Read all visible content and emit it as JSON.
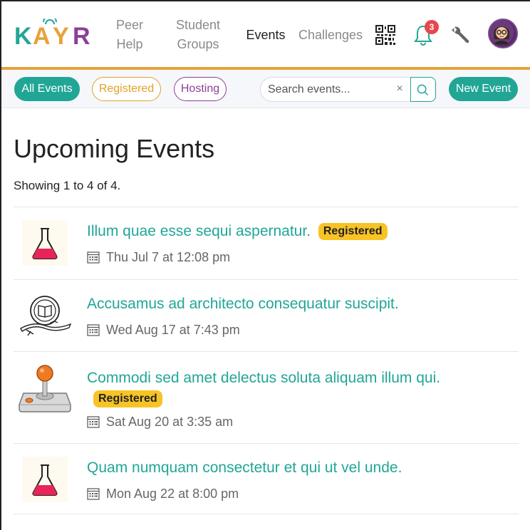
{
  "header": {
    "logo_text": "KAYR",
    "nav": [
      {
        "label_line1": "Peer",
        "label_line2": "Help"
      },
      {
        "label_line1": "Student",
        "label_line2": "Groups"
      },
      {
        "label": "Events"
      },
      {
        "label": "Challenges"
      }
    ],
    "notification_count": "3",
    "icons": [
      "qr-code-icon",
      "bell-icon",
      "wrench-icon",
      "avatar"
    ]
  },
  "filters": {
    "all": "All Events",
    "registered": "Registered",
    "hosting": "Hosting",
    "search_placeholder": "Search events...",
    "clear": "×",
    "new_event": "New Event"
  },
  "main": {
    "title": "Upcoming Events",
    "showing": "Showing 1 to 4 of 4."
  },
  "events": [
    {
      "title": "Illum quae esse sequi aspernatur.",
      "badge": "Registered",
      "date": "Thu Jul 7 at 12:08 pm",
      "icon": "flask-icon"
    },
    {
      "title": "Accusamus ad architecto consequatur suscipit.",
      "badge": "",
      "date": "Wed Aug 17 at 7:43 pm",
      "icon": "book-emblem-icon"
    },
    {
      "title": "Commodi sed amet delectus soluta aliquam illum qui.",
      "badge": "Registered",
      "date": "Sat Aug 20 at 3:35 am",
      "icon": "joystick-icon"
    },
    {
      "title": "Quam numquam consectetur et qui ut vel unde.",
      "badge": "",
      "date": "Mon Aug 22 at 8:00 pm",
      "icon": "flask-icon"
    }
  ],
  "colors": {
    "brand_teal": "#21a696",
    "registered_yellow": "#f7c325",
    "hosting_purple": "#8e3d99",
    "accent_orange": "#e6a23c",
    "badge_red": "#e5484d"
  }
}
